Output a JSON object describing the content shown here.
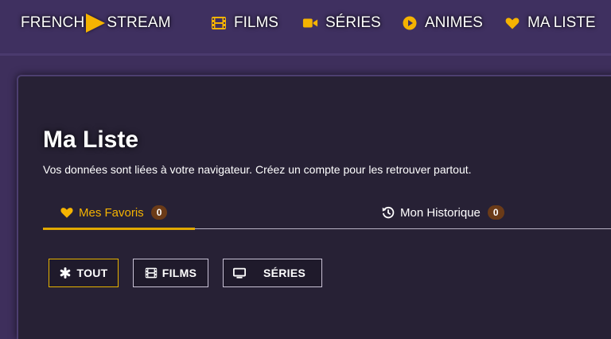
{
  "nav": {
    "logo_left": "FRENCH",
    "logo_right": "STREAM",
    "items": [
      {
        "label": "FILMS",
        "icon": "film-icon"
      },
      {
        "label": "SÉRIES",
        "icon": "video-camera-icon"
      },
      {
        "label": "ANIMES",
        "icon": "play-circle-icon"
      },
      {
        "label": "MA LISTE",
        "icon": "heart-icon"
      }
    ]
  },
  "page": {
    "title": "Ma Liste",
    "subtitle": "Vos données sont liées à votre navigateur. Créez un compte pour les retrouver partout."
  },
  "tabs": [
    {
      "label": "Mes Favoris",
      "count": "0",
      "icon": "heart-icon",
      "active": true
    },
    {
      "label": "Mon Historique",
      "count": "0",
      "icon": "history-icon",
      "active": false
    }
  ],
  "filters": [
    {
      "label": "TOUT",
      "icon": "asterisk-icon",
      "active": true
    },
    {
      "label": "FILMS",
      "icon": "film-icon",
      "active": false
    },
    {
      "label": "SÉRIES",
      "icon": "tv-icon",
      "active": false
    }
  ],
  "colors": {
    "accent": "#f5b301",
    "background": "#3e2f5c",
    "panel": "#272135",
    "badge": "#6b3b18"
  }
}
